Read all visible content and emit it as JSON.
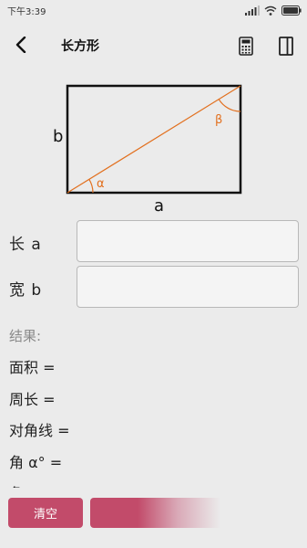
{
  "status_bar": {
    "time": "下午3:39",
    "icons": [
      "signal-icon",
      "wifi-icon",
      "battery-icon"
    ]
  },
  "app_bar": {
    "title": "长方形",
    "back_icon": "back-arrow-icon",
    "actions": [
      "calculator-icon",
      "side-panel-icon"
    ]
  },
  "diagram": {
    "side_b_label": "b",
    "side_a_label": "a",
    "angle_alpha": "α",
    "angle_beta": "β",
    "diagonal_color": "#e2701f"
  },
  "inputs": {
    "length": {
      "label": "长 a",
      "value": "",
      "placeholder": ""
    },
    "width": {
      "label": "宽 b",
      "value": "",
      "placeholder": ""
    }
  },
  "results": {
    "title": "结果:",
    "area": "面积 =",
    "perimeter": "周长 =",
    "diagonal": "对角线 =",
    "angle_alpha": "角 α° =",
    "angle_beta": "角 β° ="
  },
  "bottom_bar": {
    "clear_label": "清空"
  },
  "colors": {
    "accent": "#c24b6a",
    "background": "#ebebeb"
  }
}
